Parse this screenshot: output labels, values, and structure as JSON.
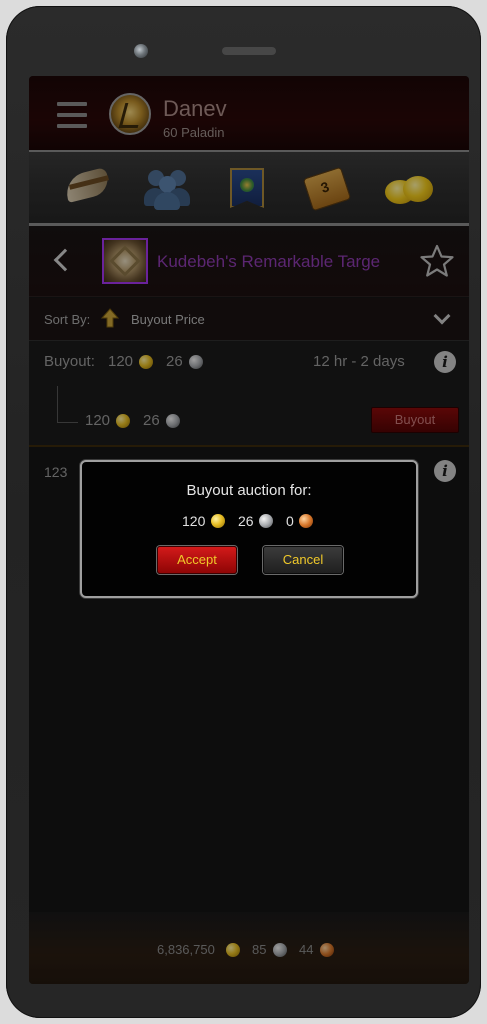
{
  "character": {
    "name": "Danev",
    "subtitle": "60 Paladin"
  },
  "nav": {
    "items": [
      {
        "icon": "horn-icon"
      },
      {
        "icon": "people-icon"
      },
      {
        "icon": "guild-banner-icon"
      },
      {
        "icon": "calendar-icon",
        "badge": "3"
      },
      {
        "icon": "gold-coins-icon"
      }
    ]
  },
  "item": {
    "name": "Kudebeh's Remarkable Targe",
    "quality_color": "#a335ee"
  },
  "sort": {
    "label": "Sort By:",
    "value": "Buyout Price"
  },
  "listings": [
    {
      "buyout_label": "Buyout:",
      "buyout_gold": "120",
      "buyout_silver": "26",
      "duration": "12 hr - 2 days",
      "price_gold": "120",
      "price_silver": "26",
      "button_label": "Buyout"
    },
    {
      "partial_value": "123"
    }
  ],
  "dialog": {
    "title": "Buyout auction for:",
    "gold": "120",
    "silver": "26",
    "copper": "0",
    "accept_label": "Accept",
    "cancel_label": "Cancel"
  },
  "footer": {
    "gold": "6,836,750",
    "silver": "85",
    "copper": "44"
  },
  "colors": {
    "accent_gold_text": "#f0c92a",
    "accept_red": "#d31a1a",
    "epic_purple": "#8d3bb0"
  }
}
